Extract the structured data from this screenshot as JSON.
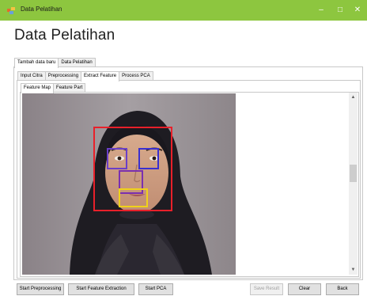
{
  "window": {
    "title": "Data Pelatihan",
    "minimize_glyph": "–",
    "maximize_glyph": "□",
    "close_glyph": "✕"
  },
  "page": {
    "heading": "Data Pelatihan"
  },
  "main_tabs": [
    {
      "label": "Tambah data baru",
      "active": true
    },
    {
      "label": "Data Pelatihan",
      "active": false
    }
  ],
  "sub_tabs": [
    {
      "label": "Input Citra",
      "active": false
    },
    {
      "label": "Preprocessing",
      "active": false
    },
    {
      "label": "Extract Feature",
      "active": true
    },
    {
      "label": "Process PCA",
      "active": false
    }
  ],
  "feature_tabs": [
    {
      "label": "Feature Map",
      "active": true
    },
    {
      "label": "Feature Part",
      "active": false
    }
  ],
  "image": {
    "description_icon": "face-photo",
    "annotation_colors": {
      "face": "#e8202a",
      "eyes": "#6a3fc8",
      "right_eye": "#3a2fd0",
      "nose": "#7a2fb0",
      "mouth": "#f0d21a"
    }
  },
  "scrollbar": {
    "up_glyph": "▲",
    "down_glyph": "▼"
  },
  "buttons": {
    "start_preprocessing": "Start Preprocessing",
    "start_feature_extraction": "Start Feature Extraction",
    "start_pca": "Start PCA",
    "save_result": "Save Result",
    "clear": "Clear",
    "back": "Back"
  },
  "colors": {
    "titlebar": "#8dc63f",
    "background": "#ffffff"
  }
}
